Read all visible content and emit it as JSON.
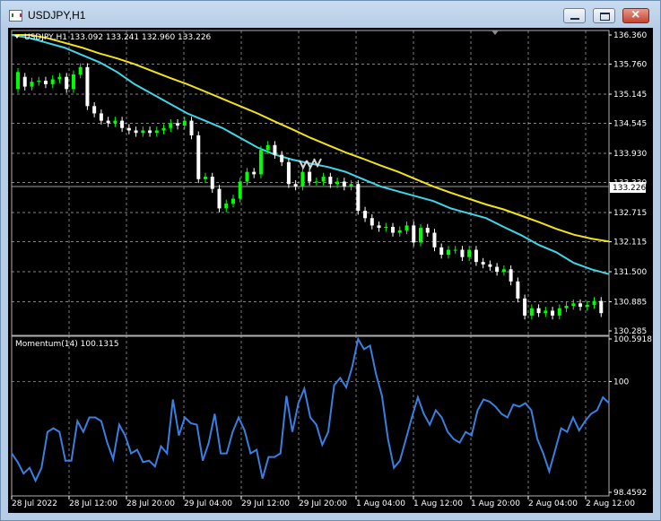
{
  "window": {
    "title": "USDJPY,H1"
  },
  "main_pane": {
    "header": "USDJPY,H1  133.092 133.241 132.960 133.226",
    "price_ticks": [
      "136.360",
      "135.760",
      "135.145",
      "134.545",
      "133.930",
      "133.330",
      "132.715",
      "132.115",
      "131.500",
      "130.885",
      "130.285"
    ],
    "current_price": "133.226"
  },
  "indicator_pane": {
    "header": "Momentum(14) 100.1315",
    "ticks": [
      "100.5918",
      "100",
      "98.4592"
    ]
  },
  "time_labels": [
    "28 Jul 2022",
    "28 Jul 12:00",
    "28 Jul 20:00",
    "29 Jul 04:00",
    "29 Jul 12:00",
    "29 Jul 20:00",
    "1 Aug 04:00",
    "1 Aug 12:00",
    "1 Aug 20:00",
    "2 Aug 04:00",
    "2 Aug 12:00"
  ],
  "colors": {
    "bull": "#00ff00",
    "bear": "#ffffff",
    "ma_fast": "#3fd6e8",
    "ma_slow": "#f2e21a",
    "momentum": "#3a7fe0",
    "grid": "#b0b0b0"
  },
  "chart_data": {
    "type": "candlestick",
    "price_range": [
      130.285,
      136.36
    ],
    "candles_close": [
      135.6,
      135.3,
      135.4,
      135.42,
      135.35,
      135.45,
      135.5,
      135.25,
      135.55,
      135.7,
      134.9,
      134.75,
      134.6,
      134.55,
      134.6,
      134.45,
      134.4,
      134.35,
      134.4,
      134.35,
      134.4,
      134.45,
      134.55,
      134.5,
      134.6,
      134.3,
      133.4,
      133.45,
      133.2,
      132.8,
      132.9,
      133.0,
      133.35,
      133.55,
      133.5,
      134.0,
      134.1,
      133.9,
      133.75,
      133.3,
      133.25,
      133.55,
      133.35,
      133.35,
      133.45,
      133.3,
      133.35,
      133.25,
      133.3,
      132.75,
      132.6,
      132.45,
      132.4,
      132.42,
      132.3,
      132.35,
      132.45,
      132.1,
      132.4,
      132.3,
      132.0,
      131.85,
      131.95,
      131.95,
      131.8,
      131.95,
      131.7,
      131.65,
      131.6,
      131.5,
      131.55,
      131.3,
      130.95,
      130.6,
      130.75,
      130.65,
      130.7,
      130.6,
      130.75,
      130.8,
      130.85,
      130.78,
      130.82,
      130.9,
      130.65
    ],
    "candles_open": [
      135.25,
      135.5,
      135.3,
      135.4,
      135.42,
      135.35,
      135.45,
      135.5,
      135.25,
      135.55,
      135.7,
      134.9,
      134.75,
      134.6,
      134.55,
      134.6,
      134.45,
      134.4,
      134.35,
      134.4,
      134.35,
      134.4,
      134.45,
      134.55,
      134.5,
      134.6,
      134.3,
      133.4,
      133.45,
      133.2,
      132.8,
      132.9,
      133.0,
      133.35,
      133.55,
      133.5,
      134.0,
      134.1,
      133.9,
      133.75,
      133.3,
      133.25,
      133.55,
      133.35,
      133.35,
      133.45,
      133.3,
      133.35,
      133.25,
      133.3,
      132.75,
      132.6,
      132.45,
      132.4,
      132.42,
      132.3,
      132.35,
      132.45,
      132.1,
      132.4,
      132.3,
      132.0,
      131.85,
      131.95,
      131.95,
      131.8,
      131.95,
      131.7,
      131.65,
      131.6,
      131.5,
      131.55,
      131.3,
      130.95,
      130.6,
      130.75,
      130.65,
      130.7,
      130.6,
      130.75,
      130.8,
      130.85,
      130.78,
      130.82,
      130.9
    ],
    "ma_fast": [
      136.36,
      136.3,
      136.2,
      136.1,
      135.95,
      135.8,
      135.6,
      135.35,
      135.15,
      134.95,
      134.75,
      134.6,
      134.45,
      134.25,
      134.05,
      133.9,
      133.8,
      133.72,
      133.65,
      133.55,
      133.4,
      133.25,
      133.15,
      133.05,
      132.95,
      132.8,
      132.7,
      132.6,
      132.42,
      132.25,
      132.05,
      131.9,
      131.68,
      131.55,
      131.45
    ],
    "ma_slow": [
      136.36,
      136.36,
      136.3,
      136.2,
      136.1,
      135.98,
      135.88,
      135.76,
      135.62,
      135.48,
      135.35,
      135.2,
      135.05,
      134.9,
      134.75,
      134.58,
      134.42,
      134.25,
      134.1,
      133.95,
      133.82,
      133.68,
      133.55,
      133.4,
      133.25,
      133.12,
      133.0,
      132.88,
      132.78,
      132.65,
      132.52,
      132.38,
      132.26,
      132.18,
      132.12
    ],
    "momentum": [
      99.0,
      98.88,
      98.72,
      98.8,
      98.62,
      98.8,
      99.3,
      99.35,
      99.3,
      98.9,
      98.9,
      99.45,
      99.3,
      99.5,
      99.5,
      99.45,
      99.15,
      98.92,
      99.4,
      99.25,
      99.0,
      99.05,
      98.88,
      98.9,
      98.82,
      99.1,
      99.0,
      99.75,
      99.25,
      99.5,
      99.42,
      99.4,
      98.9,
      99.15,
      99.55,
      99.0,
      99.0,
      99.3,
      99.5,
      99.32,
      99.0,
      99.05,
      98.65,
      98.95,
      98.95,
      99.0,
      99.8,
      99.3,
      99.7,
      99.9,
      99.5,
      99.4,
      99.12,
      99.3,
      99.95,
      100.05,
      99.92,
      100.2,
      100.59,
      100.45,
      100.5,
      100.1,
      99.8,
      99.2,
      98.8,
      98.9,
      99.2,
      99.5,
      99.78,
      99.55,
      99.4,
      99.6,
      99.5,
      99.3,
      99.2,
      99.15,
      99.3,
      99.25,
      99.6,
      99.75,
      99.72,
      99.65,
      99.55,
      99.5,
      99.68,
      99.65,
      99.7,
      99.6,
      99.2,
      99.0,
      98.75,
      99.05,
      99.35,
      99.3,
      99.5,
      99.32,
      99.45,
      99.55,
      99.6,
      99.78,
      99.7
    ]
  }
}
